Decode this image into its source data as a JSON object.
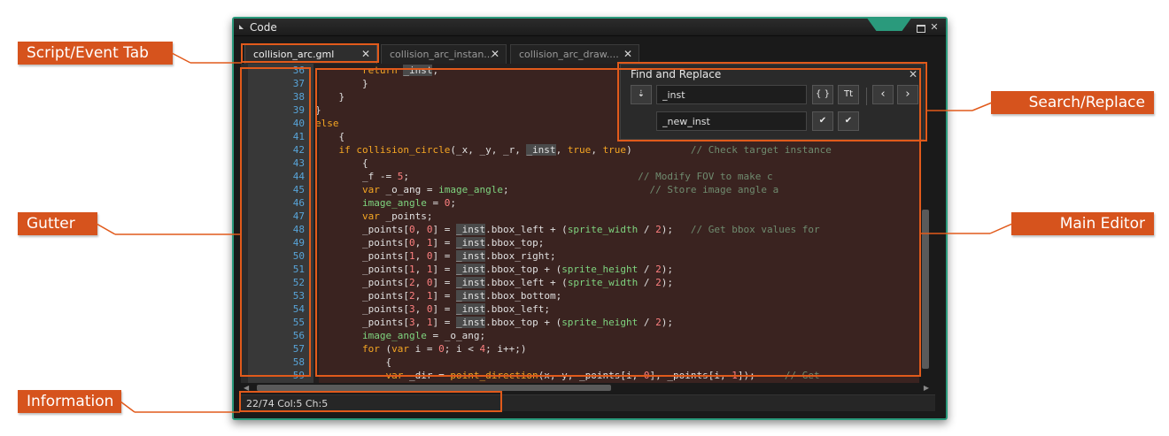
{
  "window": {
    "title": "Code"
  },
  "tabs": [
    {
      "label": "collision_arc.gml",
      "active": true
    },
    {
      "label": "collision_arc_instan...",
      "active": false
    },
    {
      "label": "collision_arc_draw....",
      "active": false
    }
  ],
  "code_lines": [
    {
      "n": "36",
      "html": "        <span class=\"kw\">return</span> <span class=\"inst\">_inst</span>;"
    },
    {
      "n": "37",
      "html": "        }"
    },
    {
      "n": "38",
      "html": "    }"
    },
    {
      "n": "39",
      "html": "}"
    },
    {
      "n": "40",
      "html": "<span class=\"kw\">else</span>"
    },
    {
      "n": "41",
      "html": "    {"
    },
    {
      "n": "42",
      "html": "    <span class=\"kw\">if</span> <span class=\"fn\">collision_circle</span>(_x, _y, _r, <span class=\"inst\">_inst</span>, <span class=\"kw\">true</span>, <span class=\"kw\">true</span>)          <span class=\"cm\">// Check target instance</span>"
    },
    {
      "n": "43",
      "html": "        {"
    },
    {
      "n": "44",
      "html": "        _f -= <span class=\"num\">5</span>;                                       <span class=\"cm\">// Modify FOV to make c</span>"
    },
    {
      "n": "45",
      "html": "        <span class=\"kw\">var</span> _o_ang = <span class=\"bi\">image_angle</span>;                        <span class=\"cm\">// Store image angle a</span>"
    },
    {
      "n": "46",
      "html": "        <span class=\"bi\">image_angle</span> = <span class=\"num\">0</span>;"
    },
    {
      "n": "47",
      "html": "        <span class=\"kw\">var</span> _points;"
    },
    {
      "n": "48",
      "html": "        _points[<span class=\"num\">0</span>, <span class=\"num\">0</span>] = <span class=\"inst\">_inst</span>.bbox_left + (<span class=\"bi\">sprite_width</span> / <span class=\"num\">2</span>);   <span class=\"cm\">// Get bbox values for</span>"
    },
    {
      "n": "49",
      "html": "        _points[<span class=\"num\">0</span>, <span class=\"num\">1</span>] = <span class=\"inst\">_inst</span>.bbox_top;"
    },
    {
      "n": "50",
      "html": "        _points[<span class=\"num\">1</span>, <span class=\"num\">0</span>] = <span class=\"inst\">_inst</span>.bbox_right;"
    },
    {
      "n": "51",
      "html": "        _points[<span class=\"num\">1</span>, <span class=\"num\">1</span>] = <span class=\"inst\">_inst</span>.bbox_top + (<span class=\"bi\">sprite_height</span> / <span class=\"num\">2</span>);"
    },
    {
      "n": "52",
      "html": "        _points[<span class=\"num\">2</span>, <span class=\"num\">0</span>] = <span class=\"inst\">_inst</span>.bbox_left + (<span class=\"bi\">sprite_width</span> / <span class=\"num\">2</span>);"
    },
    {
      "n": "53",
      "html": "        _points[<span class=\"num\">2</span>, <span class=\"num\">1</span>] = <span class=\"inst\">_inst</span>.bbox_bottom;"
    },
    {
      "n": "54",
      "html": "        _points[<span class=\"num\">3</span>, <span class=\"num\">0</span>] = <span class=\"inst\">_inst</span>.bbox_left;"
    },
    {
      "n": "55",
      "html": "        _points[<span class=\"num\">3</span>, <span class=\"num\">1</span>] = <span class=\"inst\">_inst</span>.bbox_top + (<span class=\"bi\">sprite_height</span> / <span class=\"num\">2</span>);"
    },
    {
      "n": "56",
      "html": "        <span class=\"bi\">image_angle</span> = _o_ang;"
    },
    {
      "n": "57",
      "html": "        <span class=\"kw\">for</span> (<span class=\"kw\">var</span> i = <span class=\"num\">0</span>; i &lt; <span class=\"num\">4</span>; i++;)"
    },
    {
      "n": "58",
      "html": "            {"
    },
    {
      "n": "59",
      "html": "            <span class=\"kw\">var</span> _dir = <span class=\"fn\">point_direction</span>(x, y, _points[i, <span class=\"num\">0</span>], _points[i, <span class=\"num\">1</span>]);     <span class=\"cm\">// Get</span>"
    }
  ],
  "find_replace": {
    "title": "Find and Replace",
    "find_value": "_inst",
    "replace_value": "_new_inst",
    "btn_braces": "{ }",
    "btn_case": "Tt"
  },
  "status": {
    "text": "22/74 Col:5 Ch:5"
  },
  "callouts": {
    "script_event_tab": "Script/Event Tab",
    "gutter": "Gutter",
    "information": "Information",
    "search_replace": "Search/Replace",
    "main_editor": "Main Editor"
  },
  "colors": {
    "accent_teal": "#2a9a7c",
    "callout_orange": "#d6531d",
    "keyword": "#f5a623",
    "line_number": "#58a4d8",
    "builtin": "#7fd47f",
    "number": "#ff8080",
    "comment": "#6f8b6f"
  },
  "icons": {
    "window_close": "close-icon",
    "window_maximize": "maximize-icon",
    "find_options": "find-options-icon",
    "prev": "chevron-left-icon",
    "next": "chevron-right-icon",
    "replace": "checkmark-icon",
    "replace_all": "double-checkmark-icon"
  }
}
